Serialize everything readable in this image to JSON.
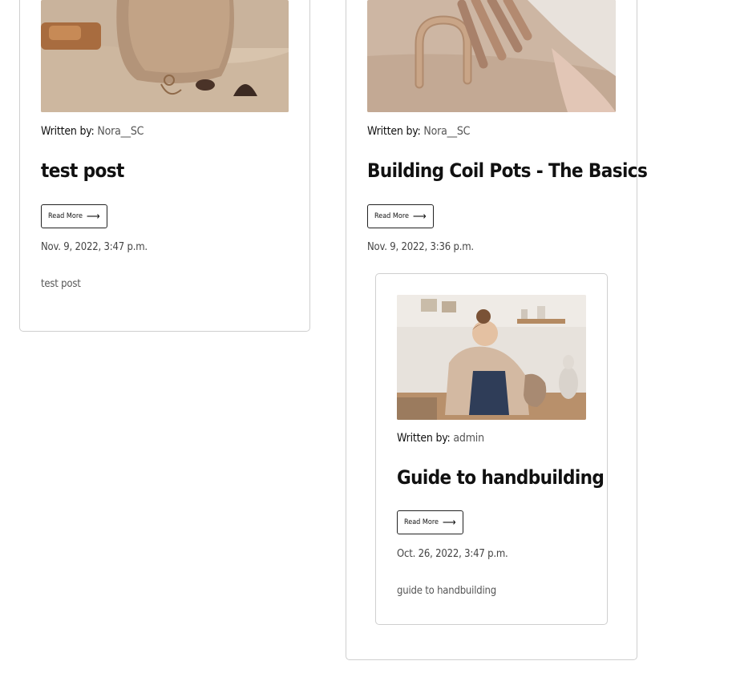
{
  "posts": [
    {
      "author_label": "Written by:",
      "author": "Nora__SC",
      "title": "test post",
      "read_more": "Read More",
      "date": "Nov. 9, 2022, 3:47 p.m.",
      "excerpt": "test post"
    },
    {
      "author_label": "Written by:",
      "author": "Nora__SC",
      "title": "Building Coil Pots - The Basics",
      "read_more": "Read More",
      "date": "Nov. 9, 2022, 3:36 p.m.",
      "excerpt": ""
    },
    {
      "author_label": "Written by:",
      "author": "admin",
      "title": "Guide to handbuilding",
      "read_more": "Read More",
      "date": "Oct. 26, 2022, 3:47 p.m.",
      "excerpt": "guide to handbuilding"
    }
  ],
  "icons": {
    "read_more_arrow": "arrow-right-icon"
  },
  "colors": {
    "border": "#cfcfcf",
    "text": "#111111",
    "muted": "#555555",
    "background": "#ffffff"
  }
}
